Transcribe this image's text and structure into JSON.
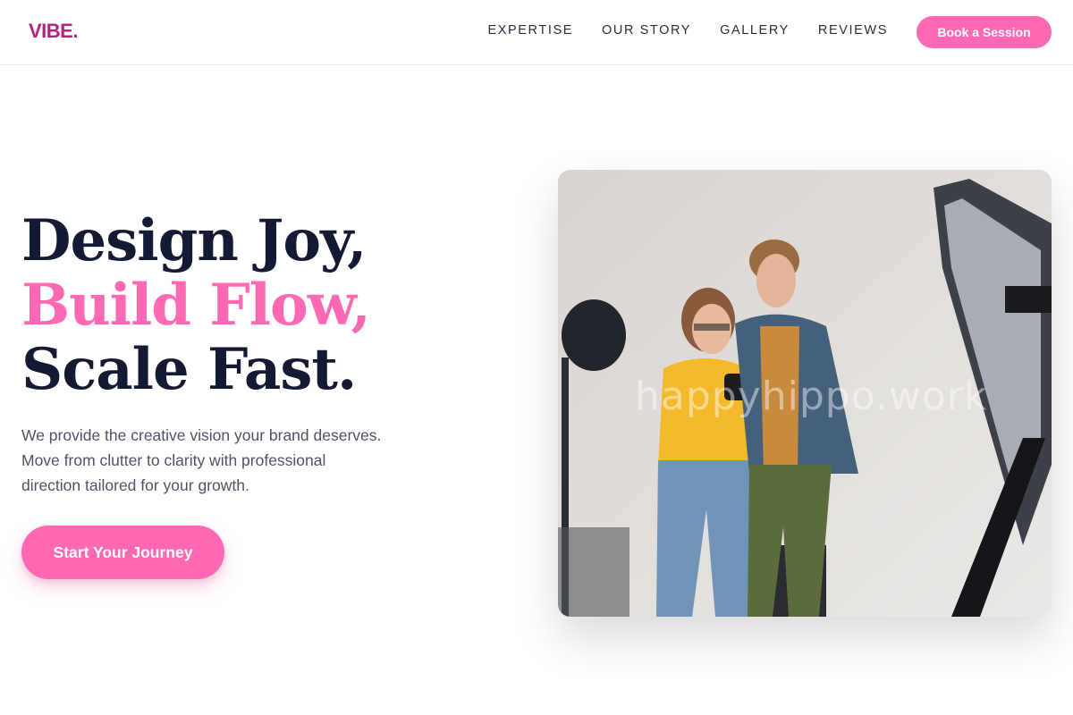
{
  "brand": {
    "logo": "VIBE.",
    "accent_color": "#ff69b4",
    "logo_color": "#b3247f"
  },
  "nav": {
    "links": [
      "EXPERTISE",
      "OUR STORY",
      "GALLERY",
      "REVIEWS"
    ],
    "book_label": "Book a Session"
  },
  "hero": {
    "headline": {
      "line1": "Design Joy,",
      "line2": "Build Flow,",
      "line3": "Scale Fast."
    },
    "description": {
      "line1": "We provide the creative vision your brand deserves.",
      "line2": "Move from clutter to clarity with professional",
      "line3": "direction tailored for your growth."
    },
    "cta_label": "Start Your Journey",
    "image_watermark": "happyhippo.work"
  }
}
